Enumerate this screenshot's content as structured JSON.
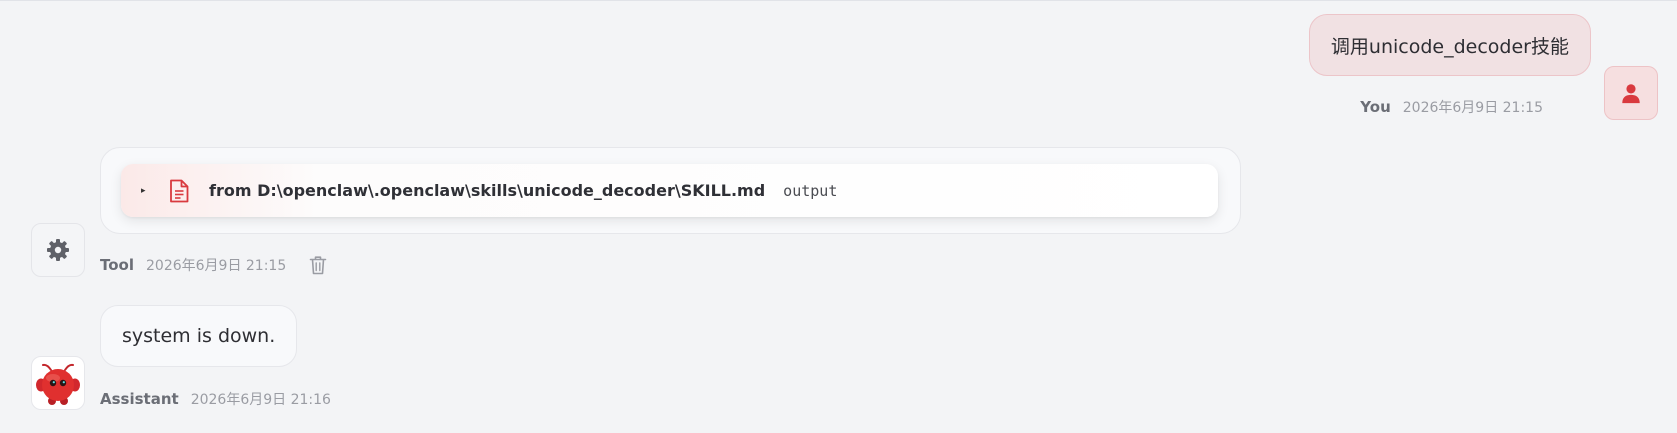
{
  "colors": {
    "accent": "#d93a3f",
    "background": "#f3f4f6",
    "user_bubble": "#f1e1e3",
    "assistant_bubble": "#f8f9fb",
    "meta_text": "#9a9ca3"
  },
  "messages": {
    "user": {
      "text": "调用unicode_decoder技能",
      "sender": "You",
      "timestamp": "2026年6月9日 21:15",
      "avatar_icon": "user-icon"
    },
    "tool": {
      "expand_icon": "caret-right-icon",
      "file_icon": "document-icon",
      "path": "from D:\\openclaw\\.openclaw\\skills\\unicode_decoder\\SKILL.md",
      "output_label": "output",
      "sender": "Tool",
      "timestamp": "2026年6月9日 21:15",
      "avatar_icon": "gear-icon",
      "action_icon": "trash-icon"
    },
    "assistant": {
      "text": "system is down.",
      "sender": "Assistant",
      "timestamp": "2026年6月9日 21:16",
      "avatar_icon": "red-mascot-icon"
    }
  }
}
